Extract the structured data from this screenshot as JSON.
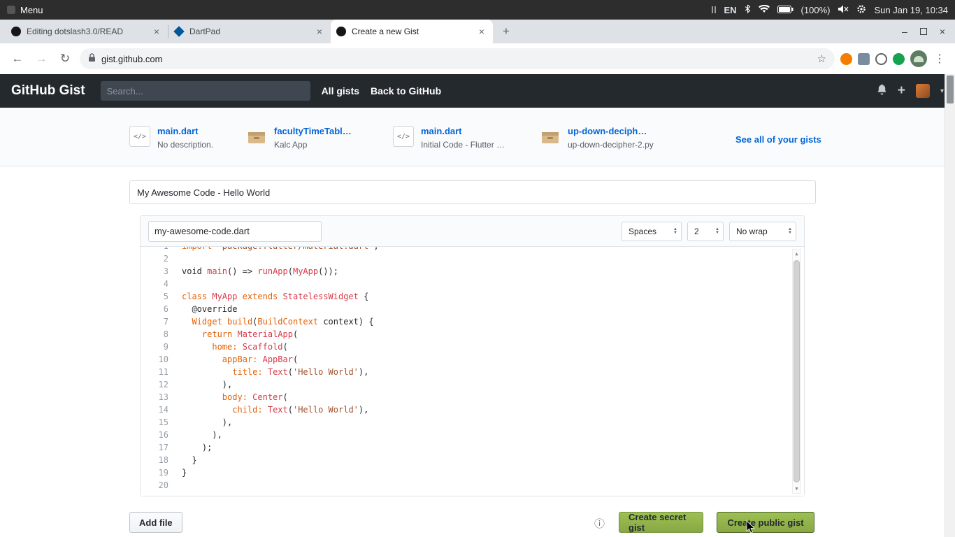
{
  "colors": {
    "link_blue": "#0366d6",
    "header_dark": "#24292e",
    "button_green": "#8fae49"
  },
  "icons": {
    "back": "←",
    "forward": "→",
    "reload": "↻",
    "star": "☆",
    "menu_kebab": "⋮",
    "close": "×",
    "plus": "+",
    "caret": "▾",
    "minimize": "–",
    "info": "ⓘ",
    "up": "▲",
    "down": "▼",
    "code": "</>"
  },
  "system_bar": {
    "menu": "Menu",
    "lang": "EN",
    "battery_pct": "(100%)",
    "clock": "Sun Jan 19, 10:34"
  },
  "browser": {
    "tabs": [
      {
        "title": "Editing dotslash3.0/READ"
      },
      {
        "title": "DartPad"
      },
      {
        "title": "Create a new Gist"
      }
    ],
    "url": "gist.github.com"
  },
  "gh": {
    "logo": "GitHub Gist",
    "search_placeholder": "Search...",
    "nav_all": "All gists",
    "nav_back": "Back to GitHub"
  },
  "recent": {
    "items": [
      {
        "name": "main.dart",
        "desc": "No description."
      },
      {
        "name": "facultyTimeTabl…",
        "desc": "Kalc App"
      },
      {
        "name": "main.dart",
        "desc": "Initial Code - Flutter …"
      },
      {
        "name": "up-down-deciph…",
        "desc": "up-down-decipher-2.py"
      }
    ],
    "see_all": "See all of your gists"
  },
  "form": {
    "description": "My Awesome Code - Hello World",
    "filename": "my-awesome-code.dart",
    "indent_mode": "Spaces",
    "indent_width": "2",
    "wrap": "No wrap"
  },
  "editor": {
    "lines": [
      {
        "n": 1,
        "t": [
          [
            "o",
            "import "
          ],
          [
            "s",
            "'package:flutter/material.dart'"
          ],
          [
            "d",
            ";"
          ]
        ]
      },
      {
        "n": 2,
        "t": []
      },
      {
        "n": 3,
        "t": [
          [
            "d",
            "void "
          ],
          [
            "r",
            "main"
          ],
          [
            "d",
            "() => "
          ],
          [
            "r",
            "runApp"
          ],
          [
            "d",
            "("
          ],
          [
            "r",
            "MyApp"
          ],
          [
            "d",
            "());"
          ]
        ]
      },
      {
        "n": 4,
        "t": []
      },
      {
        "n": 5,
        "t": [
          [
            "o",
            "class "
          ],
          [
            "r",
            "MyApp"
          ],
          [
            "o",
            " extends "
          ],
          [
            "r",
            "StatelessWidget"
          ],
          [
            "d",
            " {"
          ]
        ]
      },
      {
        "n": 6,
        "t": [
          [
            "d",
            "  @override"
          ]
        ]
      },
      {
        "n": 7,
        "t": [
          [
            "d",
            "  "
          ],
          [
            "o",
            "Widget"
          ],
          [
            "d",
            " "
          ],
          [
            "o",
            "build"
          ],
          [
            "d",
            "("
          ],
          [
            "o",
            "BuildContext"
          ],
          [
            "d",
            " context) {"
          ]
        ]
      },
      {
        "n": 8,
        "t": [
          [
            "d",
            "    "
          ],
          [
            "o",
            "return"
          ],
          [
            "d",
            " "
          ],
          [
            "r",
            "MaterialApp"
          ],
          [
            "d",
            "("
          ]
        ]
      },
      {
        "n": 9,
        "t": [
          [
            "d",
            "      "
          ],
          [
            "o",
            "home:"
          ],
          [
            "d",
            " "
          ],
          [
            "r",
            "Scaffold"
          ],
          [
            "d",
            "("
          ]
        ]
      },
      {
        "n": 10,
        "t": [
          [
            "d",
            "        "
          ],
          [
            "o",
            "appBar:"
          ],
          [
            "d",
            " "
          ],
          [
            "r",
            "AppBar"
          ],
          [
            "d",
            "("
          ]
        ]
      },
      {
        "n": 11,
        "t": [
          [
            "d",
            "          "
          ],
          [
            "o",
            "title:"
          ],
          [
            "d",
            " "
          ],
          [
            "r",
            "Text"
          ],
          [
            "d",
            "("
          ],
          [
            "s",
            "'Hello World'"
          ],
          [
            "d",
            "),"
          ]
        ]
      },
      {
        "n": 12,
        "t": [
          [
            "d",
            "        ),"
          ]
        ]
      },
      {
        "n": 13,
        "t": [
          [
            "d",
            "        "
          ],
          [
            "o",
            "body:"
          ],
          [
            "d",
            " "
          ],
          [
            "r",
            "Center"
          ],
          [
            "d",
            "("
          ]
        ]
      },
      {
        "n": 14,
        "t": [
          [
            "d",
            "          "
          ],
          [
            "o",
            "child:"
          ],
          [
            "d",
            " "
          ],
          [
            "r",
            "Text"
          ],
          [
            "d",
            "("
          ],
          [
            "s",
            "'Hello World'"
          ],
          [
            "d",
            "),"
          ]
        ]
      },
      {
        "n": 15,
        "t": [
          [
            "d",
            "        ),"
          ]
        ]
      },
      {
        "n": 16,
        "t": [
          [
            "d",
            "      ),"
          ]
        ]
      },
      {
        "n": 17,
        "t": [
          [
            "d",
            "    );"
          ]
        ]
      },
      {
        "n": 18,
        "t": [
          [
            "d",
            "  }"
          ]
        ]
      },
      {
        "n": 19,
        "t": [
          [
            "d",
            "}"
          ]
        ]
      },
      {
        "n": 20,
        "t": []
      }
    ]
  },
  "footer": {
    "add_file": "Add file",
    "create_secret": "Create secret gist",
    "create_public": "Create public gist"
  }
}
